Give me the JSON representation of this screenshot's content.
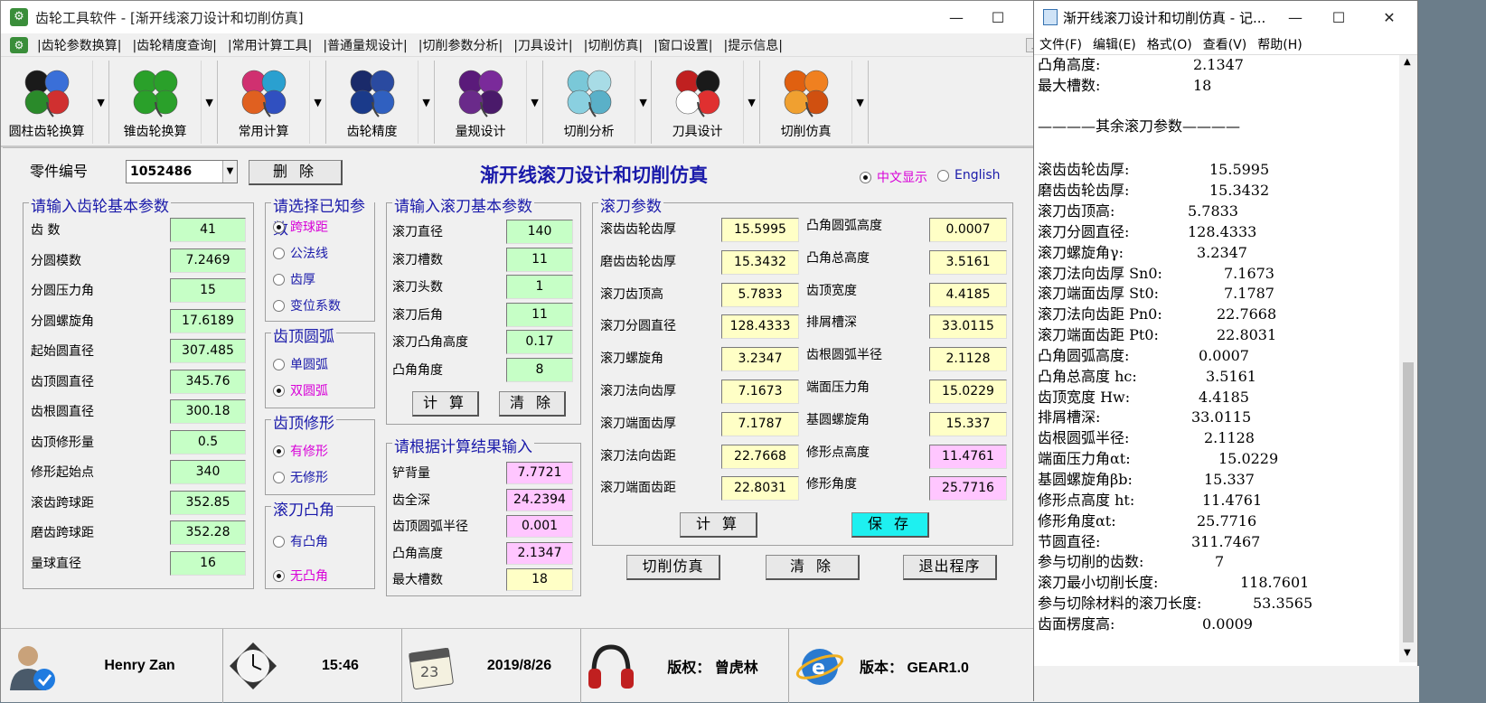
{
  "app": {
    "title": "齿轮工具软件 - [渐开线滚刀设计和切削仿真]",
    "icon": "gear-app-icon",
    "window_controls": [
      "—",
      "☐",
      "✕"
    ]
  },
  "menu": [
    "|齿轮参数换算|",
    "|齿轮精度查询|",
    "|常用计算工具|",
    "|普通量规设计|",
    "|切削参数分析|",
    "|刀具设计|",
    "|切削仿真|",
    "|窗口设置|",
    "|提示信息|"
  ],
  "mdi_controls": [
    "_",
    "❐",
    "✕"
  ],
  "toolbar": [
    {
      "label": "圆柱齿轮换算",
      "colors": [
        "#1a1a1a",
        "#3a6fd8",
        "#d03030",
        "#2a8a2a"
      ]
    },
    {
      "label": "锥齿轮换算",
      "colors": [
        "#2aa02a",
        "#2aa02a",
        "#2aa02a",
        "#2aa02a"
      ]
    },
    {
      "label": "常用计算",
      "colors": [
        "#d03070",
        "#2aa0d0",
        "#3050c0",
        "#e06020"
      ]
    },
    {
      "label": "齿轮精度",
      "colors": [
        "#1a2a6a",
        "#2a4aa0",
        "#3060c0",
        "#1a3a8a"
      ]
    },
    {
      "label": "量规设计",
      "colors": [
        "#5a1a7a",
        "#7a2a9a",
        "#4a1a6a",
        "#6a2a8a"
      ]
    },
    {
      "label": "切削分析",
      "colors": [
        "#7ac8d8",
        "#a8dce6",
        "#5ab0c8",
        "#8ad0e0"
      ]
    },
    {
      "label": "刀具设计",
      "colors": [
        "#c02020",
        "#1a1a1a",
        "#e03030",
        "#ffffff"
      ]
    },
    {
      "label": "切削仿真",
      "colors": [
        "#e06010",
        "#f08020",
        "#d05010",
        "#f0a030"
      ]
    }
  ],
  "form": {
    "part_label": "零件编号",
    "part_value": "1052486",
    "delete_btn": "删 除",
    "heading": "渐开线滚刀设计和切削仿真",
    "lang_cn": "中文显示",
    "lang_en": "English",
    "basic": {
      "legend": "请输入齿轮基本参数",
      "rows": [
        {
          "label": "齿 数",
          "value": "41"
        },
        {
          "label": "分圆模数",
          "value": "7.2469"
        },
        {
          "label": "分圆压力角",
          "value": "15"
        },
        {
          "label": "分圆螺旋角",
          "value": "17.6189"
        },
        {
          "label": "起始圆直径",
          "value": "307.485"
        },
        {
          "label": "齿顶圆直径",
          "value": "345.76"
        },
        {
          "label": "齿根圆直径",
          "value": "300.18"
        },
        {
          "label": "齿顶修形量",
          "value": "0.5"
        },
        {
          "label": "修形起始点",
          "value": "340"
        },
        {
          "label": "滚齿跨球距",
          "value": "352.85"
        },
        {
          "label": "磨齿跨球距",
          "value": "352.28"
        },
        {
          "label": "量球直径",
          "value": "16"
        }
      ]
    },
    "known": {
      "legend": "请选择已知参数",
      "options": [
        {
          "label": "跨球距",
          "checked": true
        },
        {
          "label": "公法线",
          "checked": false
        },
        {
          "label": "齿厚",
          "checked": false
        },
        {
          "label": "变位系数",
          "checked": false
        }
      ]
    },
    "arc": {
      "legend": "齿顶圆弧",
      "options": [
        {
          "label": "单圆弧",
          "checked": false
        },
        {
          "label": "双圆弧",
          "checked": true
        }
      ]
    },
    "mod": {
      "legend": "齿顶修形",
      "options": [
        {
          "label": "有修形",
          "checked": true
        },
        {
          "label": "无修形",
          "checked": false
        }
      ]
    },
    "boss": {
      "legend": "滚刀凸角",
      "options": [
        {
          "label": "有凸角",
          "checked": false
        },
        {
          "label": "无凸角",
          "checked": true
        }
      ]
    },
    "hob": {
      "legend": "请输入滚刀基本参数",
      "rows": [
        {
          "label": "滚刀直径",
          "value": "140"
        },
        {
          "label": "滚刀槽数",
          "value": "11"
        },
        {
          "label": "滚刀头数",
          "value": "1"
        },
        {
          "label": "滚刀后角",
          "value": "11"
        },
        {
          "label": "滚刀凸角高度",
          "value": "0.17"
        },
        {
          "label": "凸角角度",
          "value": "8"
        }
      ],
      "calc_btn": "计 算",
      "clear_btn": "清 除"
    },
    "result_input": {
      "legend": "请根据计算结果输入",
      "rows": [
        {
          "label": "铲背量",
          "value": "7.7721"
        },
        {
          "label": "齿全深",
          "value": "24.2394"
        },
        {
          "label": "齿顶圆弧半径",
          "value": "0.001"
        },
        {
          "label": "凸角高度",
          "value": "2.1347"
        },
        {
          "label": "最大槽数",
          "value": "18"
        }
      ]
    },
    "hobparams": {
      "legend": "滚刀参数",
      "left": [
        {
          "label": "滚齿齿轮齿厚",
          "value": "15.5995"
        },
        {
          "label": "磨齿齿轮齿厚",
          "value": "15.3432"
        },
        {
          "label": "滚刀齿顶高",
          "value": "5.7833"
        },
        {
          "label": "滚刀分圆直径",
          "value": "128.4333"
        },
        {
          "label": "滚刀螺旋角",
          "value": "3.2347"
        },
        {
          "label": "滚刀法向齿厚",
          "value": "7.1673"
        },
        {
          "label": "滚刀端面齿厚",
          "value": "7.1787"
        },
        {
          "label": "滚刀法向齿距",
          "value": "22.7668"
        },
        {
          "label": "滚刀端面齿距",
          "value": "22.8031"
        }
      ],
      "right": [
        {
          "label": "凸角圆弧高度",
          "value": "0.0007"
        },
        {
          "label": "凸角总高度",
          "value": "3.5161"
        },
        {
          "label": "齿顶宽度",
          "value": "4.4185"
        },
        {
          "label": "排屑槽深",
          "value": "33.0115"
        },
        {
          "label": "齿根圆弧半径",
          "value": "2.1128"
        },
        {
          "label": "端面压力角",
          "value": "15.0229"
        },
        {
          "label": "基圆螺旋角",
          "value": "15.337"
        },
        {
          "label": "修形点高度",
          "value": "11.4761"
        },
        {
          "label": "修形角度",
          "value": "25.7716"
        }
      ],
      "calc_btn": "计 算",
      "save_btn": "保 存"
    },
    "sim_btn": "切削仿真",
    "clear_btn2": "清 除",
    "exit_btn": "退出程序"
  },
  "status": {
    "user": "Henry Zan",
    "time": "15:46",
    "date": "2019/8/26",
    "calendar_day": "23",
    "copyright": "版权：  曾虎林",
    "version": "版本：  GEAR1.0"
  },
  "notepad": {
    "title": "渐开线滚刀设计和切削仿真 - 记...",
    "controls": [
      "—",
      "☐",
      "✕"
    ],
    "menu": [
      "文件(F)",
      "编辑(E)",
      "格式(O)",
      "查看(V)",
      "帮助(H)"
    ],
    "lines": [
      {
        "label": "凸角高度:",
        "value": "2.1347"
      },
      {
        "label": "最大槽数:",
        "value": "18"
      },
      {
        "label": "",
        "value": ""
      },
      {
        "label": "————其余滚刀参数————",
        "value": ""
      },
      {
        "label": "",
        "value": ""
      },
      {
        "label": "滚齿齿轮齿厚:",
        "value": "15.5995"
      },
      {
        "label": "磨齿齿轮齿厚:",
        "value": "15.3432"
      },
      {
        "label": "滚刀齿顶高:",
        "value": "5.7833"
      },
      {
        "label": "滚刀分圆直径:",
        "value": "128.4333"
      },
      {
        "label": "滚刀螺旋角γ:",
        "value": "3.2347"
      },
      {
        "label": "滚刀法向齿厚 Sn0:",
        "value": "7.1673"
      },
      {
        "label": "滚刀端面齿厚 St0:",
        "value": "7.1787"
      },
      {
        "label": "滚刀法向齿距 Pn0:",
        "value": "22.7668"
      },
      {
        "label": "滚刀端面齿距 Pt0:",
        "value": "22.8031"
      },
      {
        "label": "凸角圆弧高度:",
        "value": "0.0007"
      },
      {
        "label": "凸角总高度 hc:",
        "value": "3.5161"
      },
      {
        "label": "齿顶宽度 Hw:",
        "value": "4.4185"
      },
      {
        "label": "排屑槽深:",
        "value": "33.0115"
      },
      {
        "label": "齿根圆弧半径:",
        "value": "2.1128"
      },
      {
        "label": "端面压力角αt:",
        "value": "15.0229"
      },
      {
        "label": "基圆螺旋角βb:",
        "value": "15.337"
      },
      {
        "label": "修形点高度 ht:",
        "value": "11.4761"
      },
      {
        "label": "修形角度αt:",
        "value": "25.7716"
      },
      {
        "label": "节圆直径:",
        "value": "311.7467"
      },
      {
        "label": "参与切削的齿数:",
        "value": "7"
      },
      {
        "label": "滚刀最小切削长度:",
        "value": "118.7601"
      },
      {
        "label": "参与切除材料的滚刀长度:",
        "value": "53.3565"
      },
      {
        "label": "齿面楞度高:",
        "value": "0.0009"
      }
    ]
  }
}
